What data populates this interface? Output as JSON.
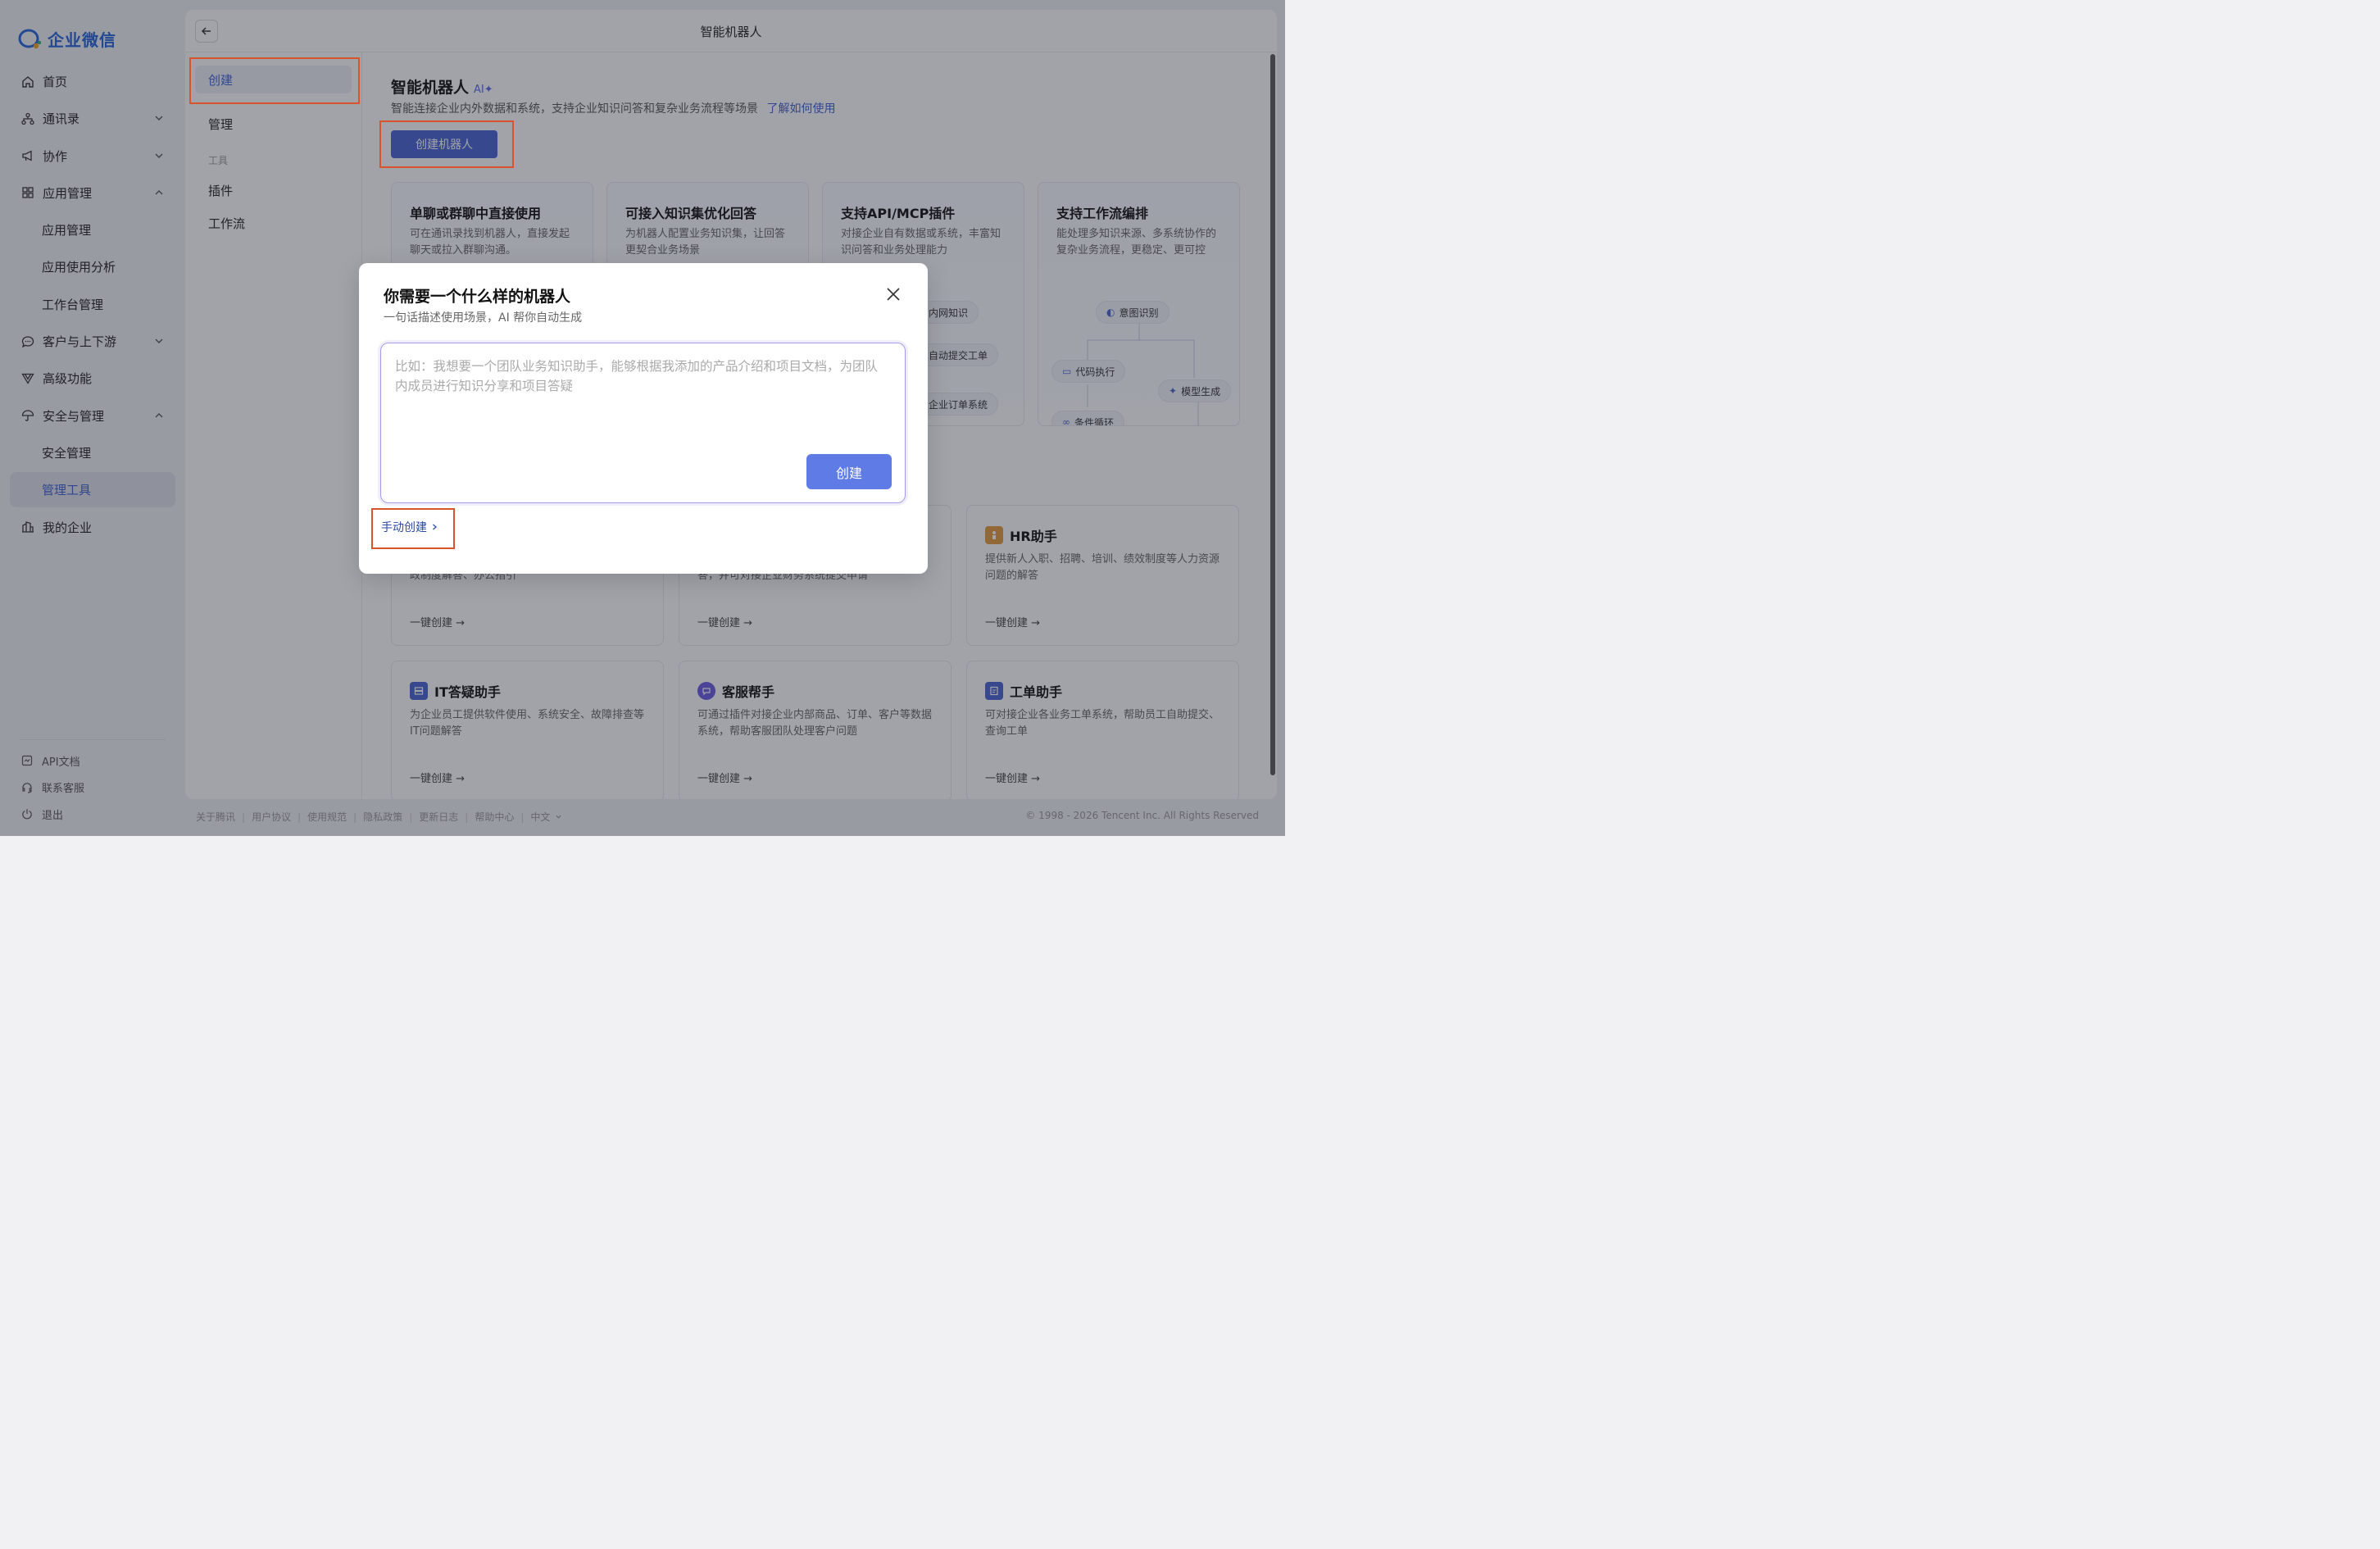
{
  "app": {
    "logo_text": "企业微信",
    "brand_color": "#2563d9",
    "accent_color": "#4a63d3"
  },
  "sidebar": {
    "items": [
      {
        "label": "首页",
        "icon": "home-icon"
      },
      {
        "label": "通讯录",
        "icon": "org-icon",
        "chevron": "down"
      },
      {
        "label": "协作",
        "icon": "megaphone-icon",
        "chevron": "down"
      },
      {
        "label": "应用管理",
        "icon": "grid-icon",
        "chevron": "up"
      },
      {
        "label": "应用管理"
      },
      {
        "label": "应用使用分析"
      },
      {
        "label": "工作台管理"
      },
      {
        "label": "客户与上下游",
        "icon": "chat-icon",
        "chevron": "down"
      },
      {
        "label": "高级功能",
        "icon": "filter-icon"
      },
      {
        "label": "安全与管理",
        "icon": "umbrella-icon",
        "chevron": "up"
      },
      {
        "label": "安全管理"
      },
      {
        "label": "管理工具",
        "active": true
      },
      {
        "label": "我的企业",
        "icon": "building-icon"
      }
    ],
    "bottom": [
      {
        "label": "API文档",
        "icon": "doc-icon"
      },
      {
        "label": "联系客服",
        "icon": "headset-icon"
      },
      {
        "label": "退出",
        "icon": "power-icon"
      }
    ]
  },
  "header": {
    "title": "智能机器人"
  },
  "subnav": {
    "create": "创建",
    "manage": "管理",
    "group_tools": "工具",
    "plugins": "插件",
    "workflow": "工作流"
  },
  "main": {
    "title": "智能机器人",
    "ai_badge": "AI✦",
    "description": "智能连接企业内外数据和系统，支持企业知识问答和复杂业务流程等场景",
    "learn_link": "了解如何使用",
    "create_button": "创建机器人",
    "features": [
      {
        "title": "单聊或群聊中直接使用",
        "desc": "可在通讯录找到机器人，直接发起聊天或拉入群聊沟通。"
      },
      {
        "title": "可接入知识集优化回答",
        "desc": "为机器人配置业务知识集，让回答更契合业务场景"
      },
      {
        "title": "支持API/MCP插件",
        "desc": "对接企业自有数据或系统，丰富知识问答和业务处理能力"
      },
      {
        "title": "支持工作流编排",
        "desc": "能处理多知识来源、多系统协作的复杂业务流程，更稳定、更可控"
      }
    ],
    "feature3_pills": [
      "内网知识",
      "自动提交工单",
      "企业订单系统"
    ],
    "feature4_pills": [
      "意图识别",
      "代码执行",
      "模型生成",
      "条件循环"
    ],
    "templates": [
      {
        "title": "",
        "desc": "政制度解答、办公指引",
        "link": "一键创建 →"
      },
      {
        "title": "",
        "desc": "答，并可对接企业财务系统提交申请",
        "link": "一键创建 →"
      },
      {
        "title": "HR助手",
        "desc": "提供新人入职、招聘、培训、绩效制度等人力资源问题的解答",
        "link": "一键创建 →",
        "icon_color": "#e69a3a"
      },
      {
        "title": "IT答疑助手",
        "desc": "为企业员工提供软件使用、系统安全、故障排查等IT问题解答",
        "link": "一键创建 →",
        "icon_color": "#4a63d3"
      },
      {
        "title": "客服帮手",
        "desc": "可通过插件对接企业内部商品、订单、客户等数据系统，帮助客服团队处理客户问题",
        "link": "一键创建 →",
        "icon_color": "#6b5be0"
      },
      {
        "title": "工单助手",
        "desc": "可对接企业各业务工单系统，帮助员工自助提交、查询工单",
        "link": "一键创建 →",
        "icon_color": "#4a63d3"
      }
    ]
  },
  "footer": {
    "links": [
      "关于腾讯",
      "用户协议",
      "使用规范",
      "隐私政策",
      "更新日志",
      "帮助中心",
      "中文"
    ],
    "copyright": "© 1998 - 2026 Tencent Inc. All Rights Reserved"
  },
  "dialog": {
    "title": "你需要一个什么样的机器人",
    "subtitle": "一句话描述使用场景，AI 帮你自动生成",
    "placeholder": "比如：我想要一个团队业务知识助手，能够根据我添加的产品介绍和项目文档，为团队内成员进行知识分享和项目答疑",
    "create_button": "创建",
    "manual_link": "手动创建"
  },
  "highlight_color": "#d9542b"
}
